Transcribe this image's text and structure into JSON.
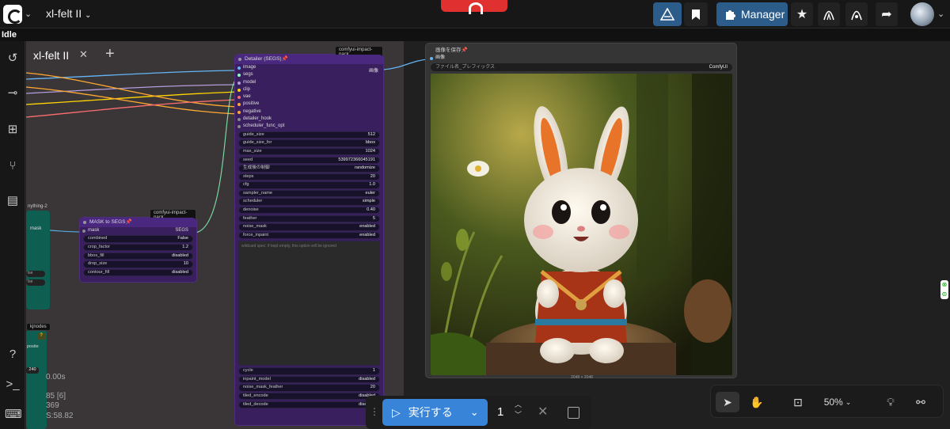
{
  "topbar": {
    "workflow_title": "xl-felt II",
    "manager_label": "Manager"
  },
  "status": "Idle",
  "tab": {
    "label": "xl-felt II"
  },
  "nodes": {
    "detailer": {
      "title": "Detailer (SEGS)📌",
      "badge": "comfyui-impact-pack",
      "inputs": [
        "image",
        "segs",
        "model",
        "clip",
        "vae",
        "positive",
        "negative",
        "detailer_hook",
        "scheduler_func_opt"
      ],
      "output": "画像",
      "widgets": [
        {
          "label": "guide_size",
          "value": "512"
        },
        {
          "label": "guide_size_for",
          "value": "bbox"
        },
        {
          "label": "max_size",
          "value": "1024"
        },
        {
          "label": "seed",
          "value": "539972366045191"
        },
        {
          "label": "生成後の制御",
          "value": "randomize"
        },
        {
          "label": "steps",
          "value": "20"
        },
        {
          "label": "cfg",
          "value": "1.0"
        },
        {
          "label": "sampler_name",
          "value": "euler"
        },
        {
          "label": "scheduler",
          "value": "simple"
        },
        {
          "label": "denoise",
          "value": "0.40"
        },
        {
          "label": "feather",
          "value": "5"
        },
        {
          "label": "noise_mask",
          "value": "enabled"
        },
        {
          "label": "force_inpaint",
          "value": "enabled"
        }
      ],
      "textarea_placeholder": "wildcard spec: if kept empty, this option will be ignored",
      "bottom_widgets": [
        {
          "label": "cycle",
          "value": "1"
        },
        {
          "label": "inpaint_model",
          "value": "disabled"
        },
        {
          "label": "noise_mask_feather",
          "value": "20"
        },
        {
          "label": "tiled_encode",
          "value": "disabled"
        },
        {
          "label": "tiled_decode",
          "value": "disabled"
        }
      ]
    },
    "mask_to_segs": {
      "title": "MASK to SEGS📌",
      "badge": "comfyui-impact-pack",
      "input": "mask",
      "output": "SEGS",
      "widgets": [
        {
          "label": "combined",
          "value": "False"
        },
        {
          "label": "crop_factor",
          "value": "1.2"
        },
        {
          "label": "bbox_fill",
          "value": "disabled"
        },
        {
          "label": "drop_size",
          "value": "10"
        },
        {
          "label": "contour_fill",
          "value": "disabled"
        }
      ]
    },
    "save_image": {
      "title": "画像を保存📌",
      "input": "画像",
      "prefix_label": "ファイル名_プレフィックス",
      "prefix_value": "ComfyUI",
      "caption": "2048 × 2048"
    },
    "left_partial": {
      "title": "nything-2",
      "output": "mask",
      "row1": "lse",
      "row2": "lse"
    },
    "kjnodes": {
      "badge": "kjnodes",
      "port": "posite",
      "value": "240",
      "q": "?"
    }
  },
  "stats": [
    "0.00s",
    "85 [6]",
    "369",
    "S:58.82"
  ],
  "run": {
    "label": "実行する",
    "count": "1"
  },
  "zoom": "50%",
  "colors": {
    "accent": "#3784d8",
    "node_purple": "#3a1f5e",
    "manager": "#2c5d8a"
  }
}
